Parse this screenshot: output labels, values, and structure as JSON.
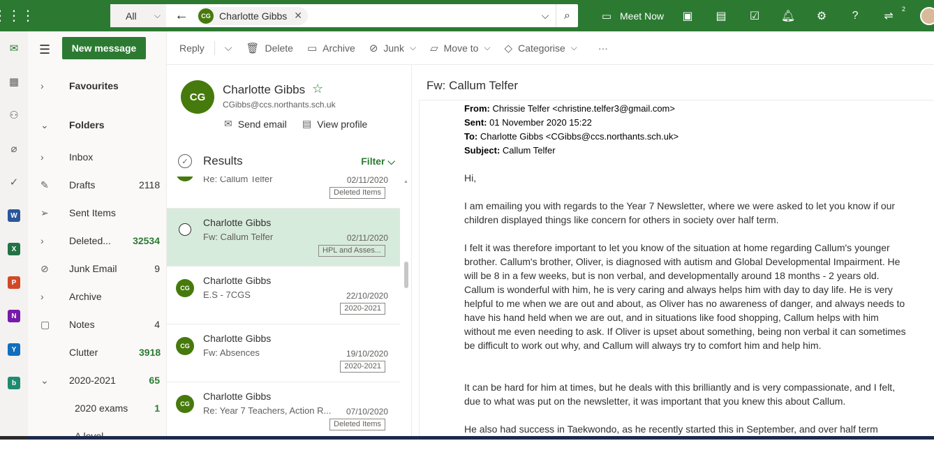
{
  "topbar": {
    "search_scope": "All",
    "search_chip_initials": "CG",
    "search_chip_name": "Charlotte Gibbs",
    "meet_now": "Meet Now",
    "notifications_badge": "2",
    "accent": "#2c7a32"
  },
  "rail": {
    "apps": [
      {
        "name": "mail-icon"
      },
      {
        "name": "calendar-icon"
      },
      {
        "name": "people-icon"
      },
      {
        "name": "attachment-icon"
      },
      {
        "name": "todo-icon"
      },
      {
        "name": "word-icon",
        "letter": "W",
        "color": "#2b579a"
      },
      {
        "name": "excel-icon",
        "letter": "X",
        "color": "#217346"
      },
      {
        "name": "powerpoint-icon",
        "letter": "P",
        "color": "#d24726"
      },
      {
        "name": "onenote-icon",
        "letter": "N",
        "color": "#7719aa"
      },
      {
        "name": "yammer-icon",
        "letter": "Y",
        "color": "#106ebe"
      },
      {
        "name": "bookings-icon",
        "letter": "b",
        "color": "#1f8a70"
      }
    ]
  },
  "folders": {
    "new_message": "New message",
    "items": [
      {
        "label": "Favourites",
        "count": "",
        "expand": "›"
      },
      {
        "label": "Folders",
        "count": "",
        "expand": "⌄"
      },
      {
        "label": "Inbox",
        "count": "",
        "expand": "›"
      },
      {
        "label": "Drafts",
        "count": "2118",
        "expand": ""
      },
      {
        "label": "Sent Items",
        "count": "",
        "expand": ""
      },
      {
        "label": "Deleted...",
        "count": "32534",
        "expand": "›"
      },
      {
        "label": "Junk Email",
        "count": "9",
        "expand": ""
      },
      {
        "label": "Archive",
        "count": "",
        "expand": "›"
      },
      {
        "label": "Notes",
        "count": "4",
        "expand": ""
      },
      {
        "label": "Clutter",
        "count": "3918",
        "expand": ""
      },
      {
        "label": "2020-2021",
        "count": "65",
        "expand": "⌄"
      },
      {
        "label": "2020 exams",
        "count": "1",
        "expand": ""
      },
      {
        "label": "A level",
        "count": "",
        "expand": "⌄"
      }
    ]
  },
  "commands": {
    "reply": "Reply",
    "delete": "Delete",
    "archive": "Archive",
    "junk": "Junk",
    "move_to": "Move to",
    "categorise": "Categorise",
    "more": "···"
  },
  "contact": {
    "initials": "CG",
    "name": "Charlotte Gibbs",
    "email": "CGibbs@ccs.northants.sch.uk",
    "send_email": "Send email",
    "view_profile": "View profile"
  },
  "results": {
    "title": "Results",
    "filter": "Filter",
    "messages": [
      {
        "from": "",
        "subject": "Re: Callum Telfer",
        "date": "02/11/2020",
        "tag": "Deleted Items",
        "initials": "CG"
      },
      {
        "from": "Charlotte Gibbs",
        "subject": "Fw: Callum Telfer",
        "date": "02/11/2020",
        "tag": "HPL and Asses...",
        "initials": ""
      },
      {
        "from": "Charlotte Gibbs",
        "subject": "E.S - 7CGS",
        "date": "22/10/2020",
        "tag": "2020-2021",
        "initials": "CG"
      },
      {
        "from": "Charlotte Gibbs",
        "subject": "Fw: Absences",
        "date": "19/10/2020",
        "tag": "2020-2021",
        "initials": "CG"
      },
      {
        "from": "Charlotte Gibbs",
        "subject": "Re: Year 7 Teachers, Action R...",
        "date": "07/10/2020",
        "tag": "Deleted Items",
        "initials": "CG"
      }
    ]
  },
  "reading": {
    "title": "Fw: Callum Telfer",
    "from_label": "From:",
    "from_value": "Chrissie Telfer <christine.telfer3@gmail.com>",
    "sent_label": "Sent:",
    "sent_value": "01 November 2020 15:22",
    "to_label": "To:",
    "to_value": "Charlotte Gibbs <CGibbs@ccs.northants.sch.uk>",
    "subject_label": "Subject:",
    "subject_value": "Callum Telfer",
    "p1": "Hi,",
    "p2": "I am emailing you with regards to the Year 7 Newsletter, where we were asked to let you know if our children displayed things like concern for others in society over half term.",
    "p3": "I felt it was therefore important to let you know of the situation at home regarding Callum's younger brother. Callum's brother, Oliver, is diagnosed with autism and Global Developmental Impairment. He will be 8 in a few weeks, but is non verbal, and developmentally around 18 months - 2 years old. Callum is wonderful with him, he is very caring and always helps him with day to  day life. He is very helpful to me when we are out and about, as Oliver has no awareness of danger, and always needs to have his hand held when we are out, and in situations like food shopping, Callum helps with him without me even needing to ask. If Oliver is upset about something, being non verbal it can sometimes be difficult to work out why, and Callum will always try to comfort him and help him.",
    "p4": "It can be hard for him at times, but he deals with this brilliantly and is very compassionate, and I felt, due to what was put on the newsletter, it was important that you knew this about Callum.",
    "p5": "He also had success in Taekwondo, as he recently started this in September, and over half term"
  }
}
